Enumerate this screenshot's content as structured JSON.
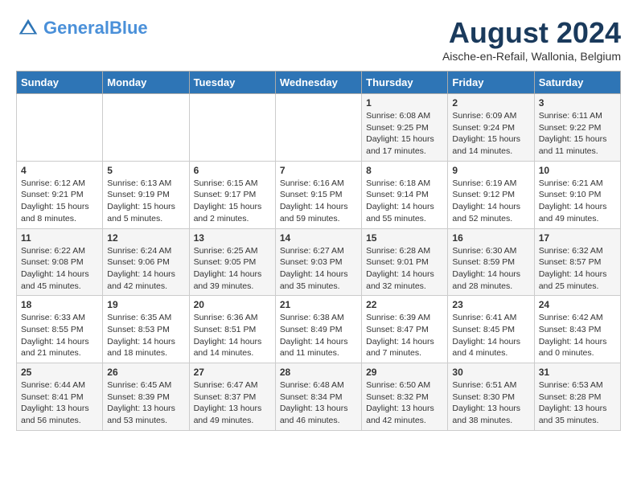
{
  "header": {
    "logo_line1": "General",
    "logo_line2": "Blue",
    "month_year": "August 2024",
    "location": "Aische-en-Refail, Wallonia, Belgium"
  },
  "weekdays": [
    "Sunday",
    "Monday",
    "Tuesday",
    "Wednesday",
    "Thursday",
    "Friday",
    "Saturday"
  ],
  "weeks": [
    [
      {
        "day": "",
        "info": ""
      },
      {
        "day": "",
        "info": ""
      },
      {
        "day": "",
        "info": ""
      },
      {
        "day": "",
        "info": ""
      },
      {
        "day": "1",
        "info": "Sunrise: 6:08 AM\nSunset: 9:25 PM\nDaylight: 15 hours\nand 17 minutes."
      },
      {
        "day": "2",
        "info": "Sunrise: 6:09 AM\nSunset: 9:24 PM\nDaylight: 15 hours\nand 14 minutes."
      },
      {
        "day": "3",
        "info": "Sunrise: 6:11 AM\nSunset: 9:22 PM\nDaylight: 15 hours\nand 11 minutes."
      }
    ],
    [
      {
        "day": "4",
        "info": "Sunrise: 6:12 AM\nSunset: 9:21 PM\nDaylight: 15 hours\nand 8 minutes."
      },
      {
        "day": "5",
        "info": "Sunrise: 6:13 AM\nSunset: 9:19 PM\nDaylight: 15 hours\nand 5 minutes."
      },
      {
        "day": "6",
        "info": "Sunrise: 6:15 AM\nSunset: 9:17 PM\nDaylight: 15 hours\nand 2 minutes."
      },
      {
        "day": "7",
        "info": "Sunrise: 6:16 AM\nSunset: 9:15 PM\nDaylight: 14 hours\nand 59 minutes."
      },
      {
        "day": "8",
        "info": "Sunrise: 6:18 AM\nSunset: 9:14 PM\nDaylight: 14 hours\nand 55 minutes."
      },
      {
        "day": "9",
        "info": "Sunrise: 6:19 AM\nSunset: 9:12 PM\nDaylight: 14 hours\nand 52 minutes."
      },
      {
        "day": "10",
        "info": "Sunrise: 6:21 AM\nSunset: 9:10 PM\nDaylight: 14 hours\nand 49 minutes."
      }
    ],
    [
      {
        "day": "11",
        "info": "Sunrise: 6:22 AM\nSunset: 9:08 PM\nDaylight: 14 hours\nand 45 minutes."
      },
      {
        "day": "12",
        "info": "Sunrise: 6:24 AM\nSunset: 9:06 PM\nDaylight: 14 hours\nand 42 minutes."
      },
      {
        "day": "13",
        "info": "Sunrise: 6:25 AM\nSunset: 9:05 PM\nDaylight: 14 hours\nand 39 minutes."
      },
      {
        "day": "14",
        "info": "Sunrise: 6:27 AM\nSunset: 9:03 PM\nDaylight: 14 hours\nand 35 minutes."
      },
      {
        "day": "15",
        "info": "Sunrise: 6:28 AM\nSunset: 9:01 PM\nDaylight: 14 hours\nand 32 minutes."
      },
      {
        "day": "16",
        "info": "Sunrise: 6:30 AM\nSunset: 8:59 PM\nDaylight: 14 hours\nand 28 minutes."
      },
      {
        "day": "17",
        "info": "Sunrise: 6:32 AM\nSunset: 8:57 PM\nDaylight: 14 hours\nand 25 minutes."
      }
    ],
    [
      {
        "day": "18",
        "info": "Sunrise: 6:33 AM\nSunset: 8:55 PM\nDaylight: 14 hours\nand 21 minutes."
      },
      {
        "day": "19",
        "info": "Sunrise: 6:35 AM\nSunset: 8:53 PM\nDaylight: 14 hours\nand 18 minutes."
      },
      {
        "day": "20",
        "info": "Sunrise: 6:36 AM\nSunset: 8:51 PM\nDaylight: 14 hours\nand 14 minutes."
      },
      {
        "day": "21",
        "info": "Sunrise: 6:38 AM\nSunset: 8:49 PM\nDaylight: 14 hours\nand 11 minutes."
      },
      {
        "day": "22",
        "info": "Sunrise: 6:39 AM\nSunset: 8:47 PM\nDaylight: 14 hours\nand 7 minutes."
      },
      {
        "day": "23",
        "info": "Sunrise: 6:41 AM\nSunset: 8:45 PM\nDaylight: 14 hours\nand 4 minutes."
      },
      {
        "day": "24",
        "info": "Sunrise: 6:42 AM\nSunset: 8:43 PM\nDaylight: 14 hours\nand 0 minutes."
      }
    ],
    [
      {
        "day": "25",
        "info": "Sunrise: 6:44 AM\nSunset: 8:41 PM\nDaylight: 13 hours\nand 56 minutes."
      },
      {
        "day": "26",
        "info": "Sunrise: 6:45 AM\nSunset: 8:39 PM\nDaylight: 13 hours\nand 53 minutes."
      },
      {
        "day": "27",
        "info": "Sunrise: 6:47 AM\nSunset: 8:37 PM\nDaylight: 13 hours\nand 49 minutes."
      },
      {
        "day": "28",
        "info": "Sunrise: 6:48 AM\nSunset: 8:34 PM\nDaylight: 13 hours\nand 46 minutes."
      },
      {
        "day": "29",
        "info": "Sunrise: 6:50 AM\nSunset: 8:32 PM\nDaylight: 13 hours\nand 42 minutes."
      },
      {
        "day": "30",
        "info": "Sunrise: 6:51 AM\nSunset: 8:30 PM\nDaylight: 13 hours\nand 38 minutes."
      },
      {
        "day": "31",
        "info": "Sunrise: 6:53 AM\nSunset: 8:28 PM\nDaylight: 13 hours\nand 35 minutes."
      }
    ]
  ]
}
